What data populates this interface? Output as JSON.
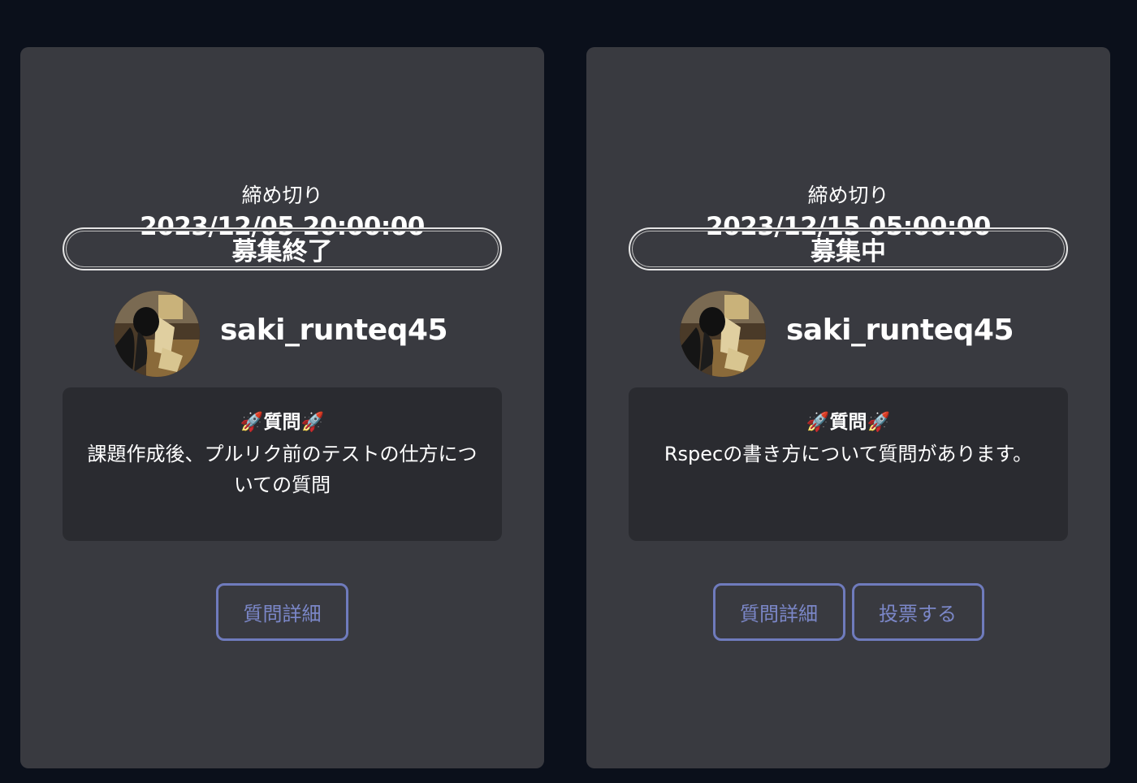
{
  "cards": [
    {
      "deadline_label": "締め切り",
      "deadline_value": "2023/12/05 20:00:00",
      "status": "募集終了",
      "username": "saki_runteq45",
      "question_head": "🚀質問🚀",
      "question_body": "課題作成後、プルリク前のテストの仕方についての質問",
      "buttons": [
        "質問詳細"
      ]
    },
    {
      "deadline_label": "締め切り",
      "deadline_value": "2023/12/15 05:00:00",
      "status": "募集中",
      "username": "saki_runteq45",
      "question_head": "🚀質問🚀",
      "question_body": "Rspecの書き方について質問があります。",
      "buttons": [
        "質問詳細",
        "投票する"
      ]
    }
  ],
  "colors": {
    "page_background": "#0b101b",
    "card_background": "#393a40",
    "question_box_background": "#2a2b30",
    "button_accent": "#6f7bbd"
  }
}
